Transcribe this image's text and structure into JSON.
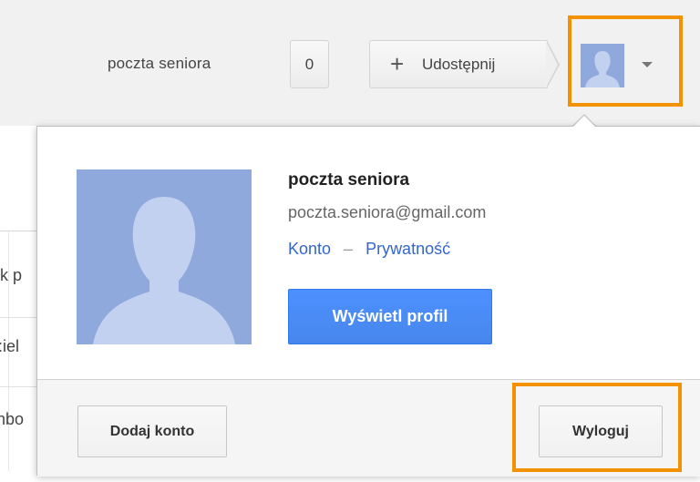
{
  "header": {
    "username": "poczta seniora",
    "notification_count": "0",
    "share_label": "Udostępnij",
    "share_icon": "plus-icon",
    "avatar_icon": "user-silhouette-icon",
    "menu_icon": "chevron-down-icon"
  },
  "account_popup": {
    "name": "poczta seniora",
    "email": "poczta.seniora@gmail.com",
    "links": {
      "account": "Konto",
      "separator": "–",
      "privacy": "Prywatność"
    },
    "view_profile_label": "Wyświetl profil",
    "add_account_label": "Dodaj konto",
    "logout_label": "Wyloguj"
  },
  "background_fragments": [
    "k p",
    ":iel",
    "nbo"
  ],
  "colors": {
    "highlight": "#f39200",
    "primary_button": "#4d90fe",
    "link": "#3366cc",
    "avatar": "#8fa9dd",
    "silhouette": "#c2d1f0"
  }
}
